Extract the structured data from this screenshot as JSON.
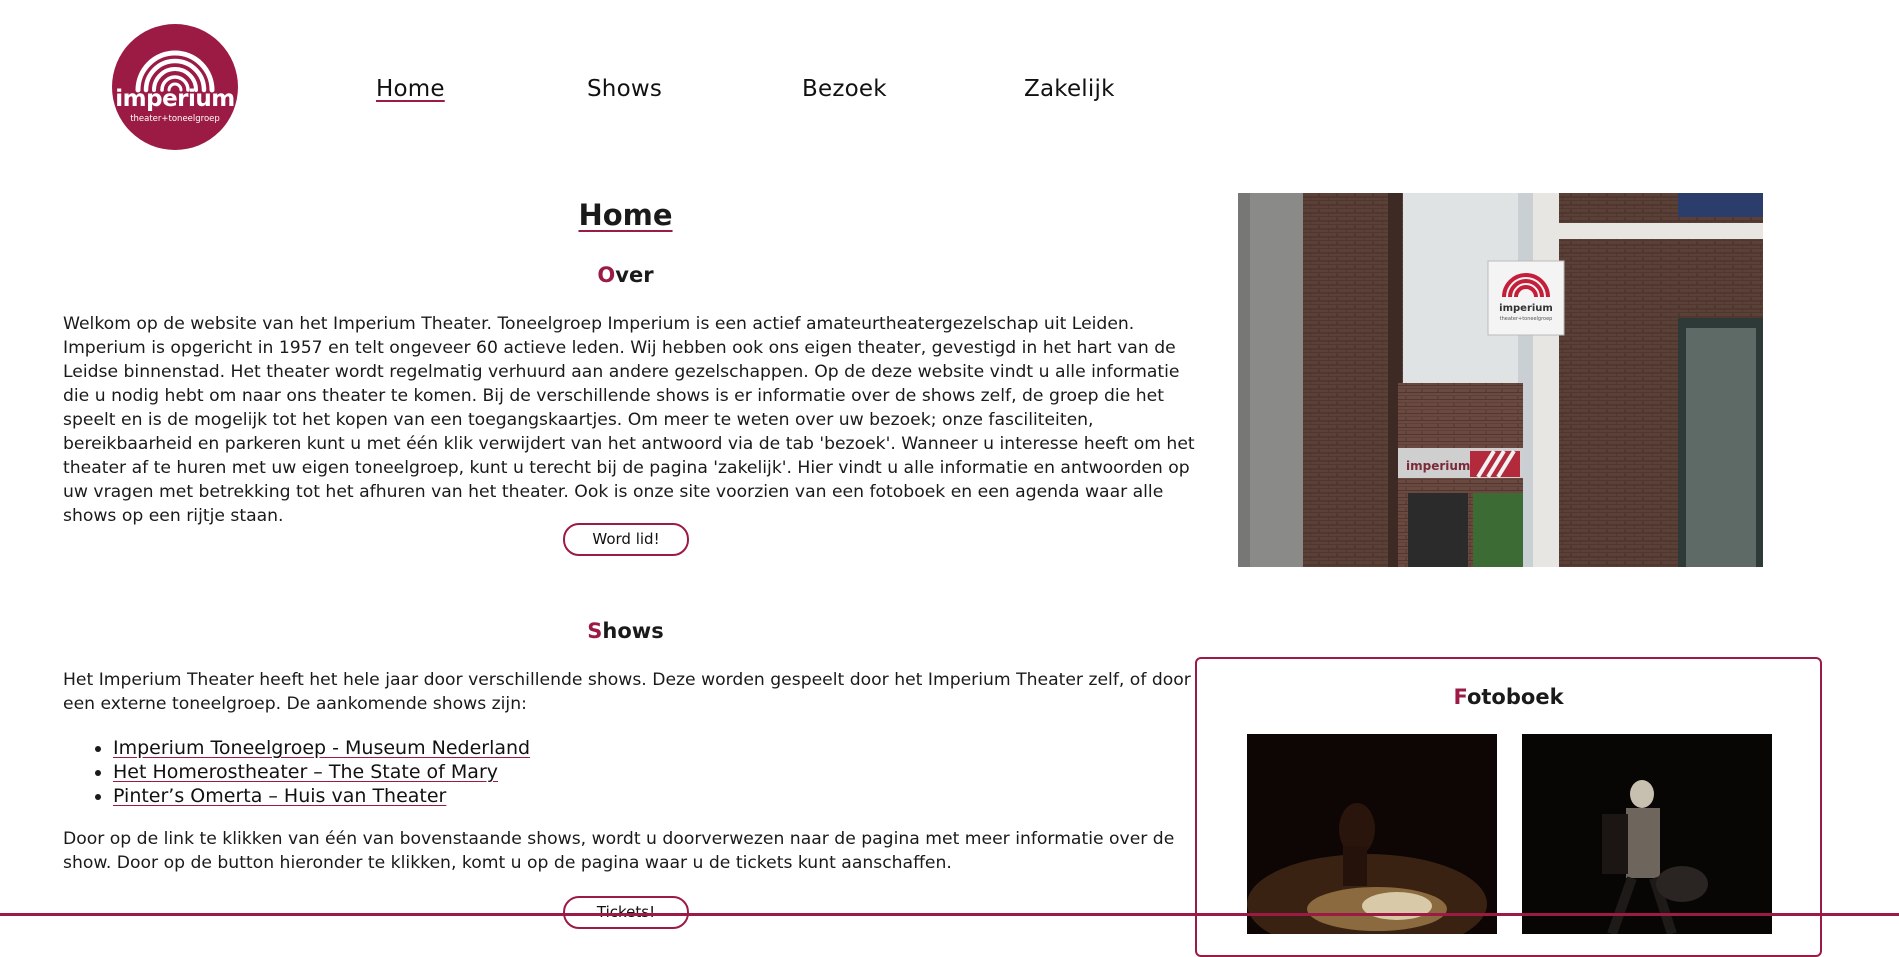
{
  "logo": {
    "name": "imperium",
    "subtitle": "theater+toneelgroep"
  },
  "nav": [
    "Home",
    "Shows",
    "Bezoek",
    "Zakelijk"
  ],
  "page_title": "Home",
  "over": {
    "first_letter": "O",
    "rest": "ver",
    "text": "Welkom op de website van het Imperium Theater. Toneelgroep Imperium is een actief amateurtheatergezelschap uit Leiden. Imperium is opgericht in 1957 en telt ongeveer 60 actieve leden. Wij hebben ook ons eigen theater, gevestigd in het hart van de Leidse binnenstad. Het theater wordt regelmatig verhuurd aan andere gezelschappen. Op de deze website vindt u alle informatie die u nodig hebt om naar ons theater te komen. Bij de verschillende shows is er informatie over de shows zelf, de groep die het speelt en is de mogelijk tot het kopen van een toegangskaartjes. Om meer te weten over uw bezoek; onze fasciliteiten, bereikbaarheid en parkeren kunt u met één klik verwijdert van het antwoord via de tab 'bezoek'. Wanneer u interesse heeft om het theater af te huren met uw eigen toneelgroep, kunt u terecht bij de pagina 'zakelijk'. Hier vindt u alle informatie en antwoorden op uw vragen met betrekking tot het afhuren van het theater. Ook is onze site voorzien van een fotoboek en een agenda waar alle shows op een rijtje staan.",
    "button": "Word lid!"
  },
  "shows": {
    "first_letter": "S",
    "rest": "hows",
    "intro": "Het Imperium Theater heeft het hele jaar door verschillende shows. Deze worden gespeelt door het Imperium Theater zelf, of door een externe toneelgroep. De aankomende shows zijn:",
    "items": [
      "Imperium Toneelgroep - Museum Nederland",
      "Het Homerostheater – The State of Mary",
      "Pinter’s Omerta – Huis van Theater"
    ],
    "outro": "Door op de link te klikken van één van bovenstaande shows, wordt u doorverwezen naar de pagina met meer informatie over de show. Door op de button hieronder te klikken, komt u op de pagina waar u de tickets kunt aanschaffen.",
    "button": "Tickets!"
  },
  "photo_sign": {
    "name": "imperium",
    "subtitle": "theater+toneelgroep"
  },
  "fotoboek": {
    "first_letter": "F",
    "rest": "otoboek"
  },
  "colors": {
    "accent": "#9b1b45",
    "text": "#1a1a1a",
    "background": "#ffffff"
  }
}
